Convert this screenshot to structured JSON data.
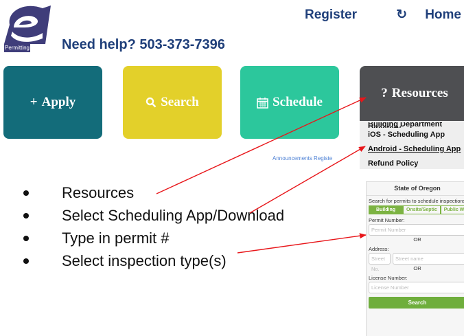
{
  "header": {
    "logo_badge": "Permitting",
    "help_text": "Need help? 503-373-7396",
    "register_label": "Register",
    "home_icon": "refresh-icon",
    "home_label": "Home"
  },
  "tiles": {
    "apply": {
      "icon": "+",
      "label": "Apply"
    },
    "search": {
      "icon": "Q",
      "label": "Search"
    },
    "schedule": {
      "icon": "▦",
      "label": "Schedule"
    },
    "resources": {
      "icon": "?",
      "label": "Resources"
    }
  },
  "resources_menu": {
    "cut_item": "Building Department Directory",
    "items": [
      "iOS - Scheduling App",
      "Android - Scheduling App",
      "Refund Policy"
    ]
  },
  "sublinks": "Announcements   Registe",
  "bullets": [
    "Resources",
    "Select Scheduling App/Download",
    "Type in permit #",
    "Select inspection type(s)"
  ],
  "app_form": {
    "title": "State of Oregon",
    "description": "Search for permits to schedule inspections",
    "tabs": [
      "Building",
      "Onsite/Septic",
      "Public Wo"
    ],
    "permit_label": "Permit Number:",
    "permit_placeholder": "Permit Number",
    "or_text": "OR",
    "address_label": "Address:",
    "street_no_placeholder": "Street No.",
    "street_name_placeholder": "Street name",
    "license_label": "License Number:",
    "license_placeholder": "License Number",
    "search_label": "Search"
  },
  "colors": {
    "apply": "#136c7a",
    "search": "#e3d02a",
    "schedule": "#2cc79c",
    "resources": "#4e4f52",
    "arrow": "#e8161a",
    "form_accent": "#7cb342"
  }
}
